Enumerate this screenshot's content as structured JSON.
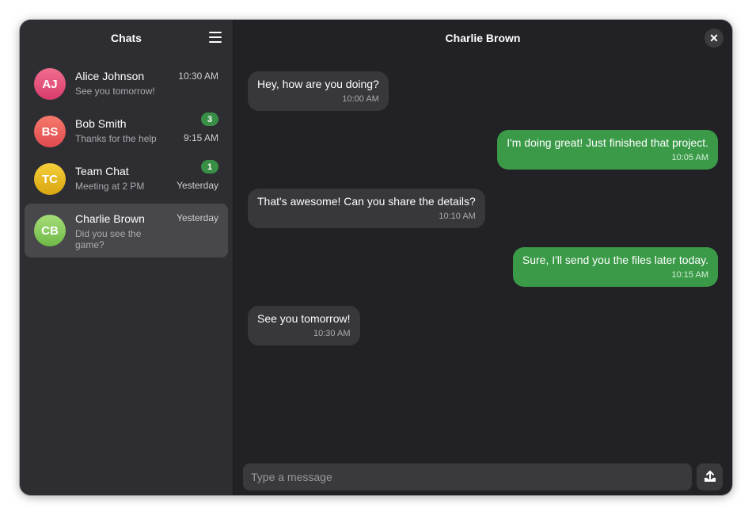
{
  "sidebar": {
    "title": "Chats",
    "menu_icon": "hamburger-menu-icon",
    "chats": [
      {
        "initials": "AJ",
        "name": "Alice Johnson",
        "preview": "See you tomorrow!",
        "time": "10:30 AM",
        "badge": "",
        "avatar_color": "#e5557f"
      },
      {
        "initials": "BS",
        "name": "Bob Smith",
        "preview": "Thanks for the help",
        "time": "9:15 AM",
        "badge": "3",
        "avatar_color": "#ef5f5a"
      },
      {
        "initials": "TC",
        "name": "Team Chat",
        "preview": "Meeting at 2 PM",
        "time": "Yesterday",
        "badge": "1",
        "avatar_color": "#e8b820"
      },
      {
        "initials": "CB",
        "name": "Charlie Brown",
        "preview": "Did you see the game?",
        "time": "Yesterday",
        "badge": "",
        "avatar_color": "#8ccc5a"
      }
    ]
  },
  "conversation": {
    "title": "Charlie Brown",
    "close_icon": "close-icon",
    "messages": [
      {
        "direction": "in",
        "text": "Hey, how are you doing?",
        "time": "10:00 AM"
      },
      {
        "direction": "out",
        "text": "I'm doing great! Just finished that project.",
        "time": "10:05 AM"
      },
      {
        "direction": "in",
        "text": "That's awesome! Can you share the details?",
        "time": "10:10 AM"
      },
      {
        "direction": "out",
        "text": "Sure, I'll send you the files later today.",
        "time": "10:15 AM"
      },
      {
        "direction": "in",
        "text": "See you tomorrow!",
        "time": "10:30 AM"
      }
    ]
  },
  "composer": {
    "placeholder": "Type a message",
    "value": "",
    "send_icon": "send-icon"
  },
  "colors": {
    "accent": "#3a9a48",
    "badge": "#3a8f47",
    "selected_row": "#48484c"
  }
}
